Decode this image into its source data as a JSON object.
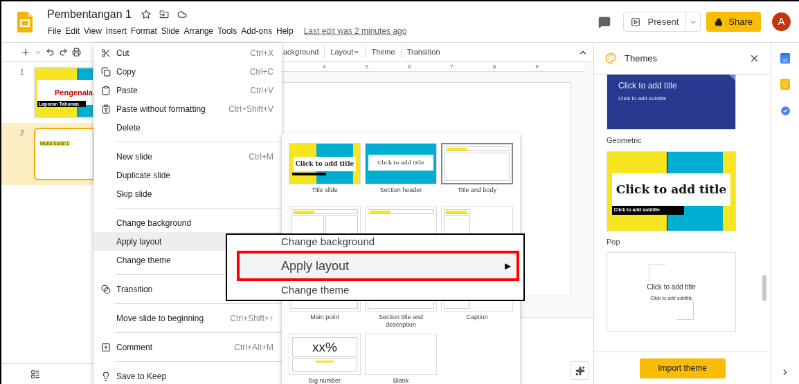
{
  "document": {
    "title": "Pembentangan 1",
    "last_edit": "Last edit was 2 minutes ago"
  },
  "menu_bar": [
    "File",
    "Edit",
    "View",
    "Insert",
    "Format",
    "Slide",
    "Arrange",
    "Tools",
    "Add-ons",
    "Help"
  ],
  "header_actions": {
    "present": "Present",
    "share": "Share",
    "avatar": "A"
  },
  "toolbar": [
    {
      "label": "ackground",
      "caret": false
    },
    {
      "label": "Layout",
      "caret": true
    },
    {
      "label": "Theme",
      "caret": false
    },
    {
      "label": "Transition",
      "caret": false
    }
  ],
  "ruler": [
    "4",
    "5",
    "6",
    "7",
    "8",
    "9"
  ],
  "filmstrip": [
    {
      "number": "1",
      "kind": "title",
      "selected": false,
      "title": "Pengenala",
      "subtitle": "Laporan Tahunan"
    },
    {
      "number": "2",
      "kind": "body",
      "selected": true,
      "title": "Muka Surat 1"
    }
  ],
  "context_menu": {
    "sections": [
      [
        {
          "label": "Cut",
          "shortcut": "Ctrl+X",
          "highlighted": false
        },
        {
          "label": "Copy",
          "shortcut": "Ctrl+C",
          "highlighted": false
        },
        {
          "label": "Paste",
          "shortcut": "Ctrl+V",
          "highlighted": false
        },
        {
          "label": "Paste without formatting",
          "shortcut": "Ctrl+Shift+V",
          "highlighted": false
        },
        {
          "label": "Delete",
          "highlighted": false
        }
      ],
      [
        {
          "label": "New slide",
          "shortcut": "Ctrl+M",
          "highlighted": false
        },
        {
          "label": "Duplicate slide",
          "highlighted": false
        },
        {
          "label": "Skip slide",
          "highlighted": false
        }
      ],
      [
        {
          "label": "Change background",
          "highlighted": false
        },
        {
          "label": "Apply layout",
          "highlighted": true
        },
        {
          "label": "Change theme",
          "highlighted": false
        }
      ],
      [
        {
          "label": "Transition",
          "highlighted": false
        }
      ],
      [
        {
          "label": "Move slide to beginning",
          "shortcut": "Ctrl+Shift+↑",
          "highlighted": false
        }
      ],
      [
        {
          "label": "Comment",
          "shortcut": "Ctrl+Alt+M",
          "highlighted": false
        }
      ],
      [
        {
          "label": "Save to Keep",
          "highlighted": false
        }
      ]
    ]
  },
  "layout_menu": [
    {
      "kind": "title-slide",
      "label": "Title slide",
      "selected": false,
      "title": "Click to add title"
    },
    {
      "kind": "section-header",
      "label": "Section header",
      "selected": false,
      "title": "Click to add title"
    },
    {
      "kind": "title-body",
      "label": "Title and body",
      "selected": true
    },
    {
      "kind": "two-columns",
      "selected": false
    },
    {
      "kind": "title-only",
      "selected": false
    },
    {
      "kind": "one-column",
      "selected": false
    },
    {
      "kind": "main-point",
      "label": "Main point",
      "selected": false
    },
    {
      "kind": "section-description",
      "label": "Section title and description",
      "selected": false
    },
    {
      "kind": "caption",
      "label": "Caption",
      "selected": false
    },
    {
      "kind": "big-number",
      "label": "Big number",
      "selected": false,
      "title": "xx%"
    },
    {
      "kind": "blank",
      "label": "Blank",
      "selected": false
    }
  ],
  "callout": {
    "above": "Change background",
    "label": "Apply layout",
    "arrow": "▶",
    "below": "Change theme"
  },
  "themes_panel": {
    "title": "Themes",
    "themes": [
      {
        "kind": "geometric",
        "name": "Geometric",
        "title": "Click to add title",
        "subtitle": "Click to add subtitle"
      },
      {
        "kind": "pop",
        "name": "Pop",
        "title": "Click to add title",
        "subtitle": "Click to add subtitle"
      },
      {
        "kind": "minimal",
        "title": "Click to add title",
        "subtitle": "Click to add subtitle"
      }
    ],
    "import": "Import theme"
  },
  "side_rail": {
    "calendar_day": "31"
  }
}
